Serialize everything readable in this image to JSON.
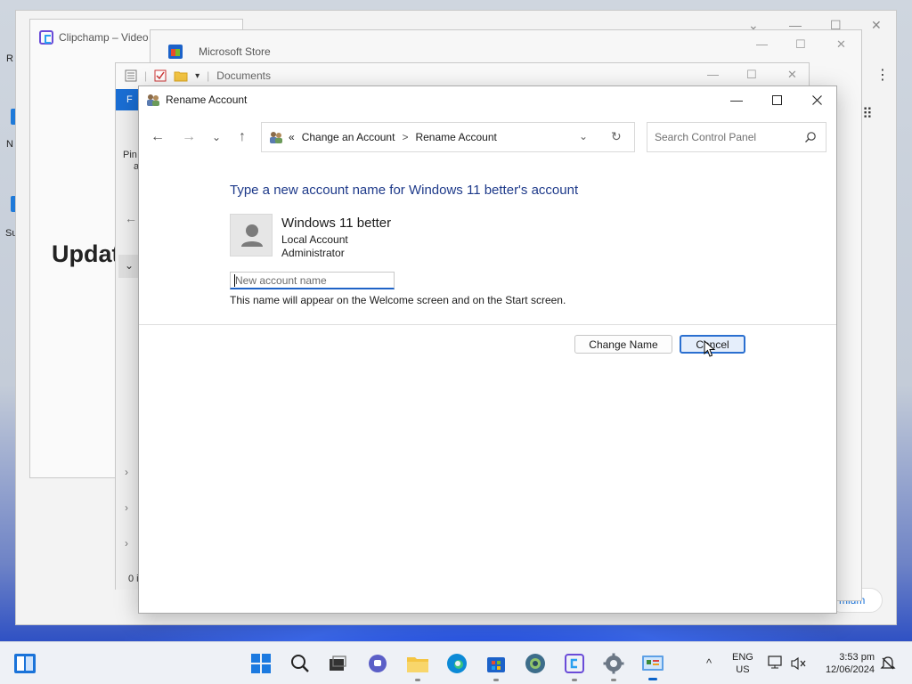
{
  "background": {
    "clipchamp": {
      "title": "Clipchamp – Video",
      "heading": "Updat"
    },
    "store": {
      "title": "Microsoft Store"
    },
    "documents": {
      "title": "Documents",
      "ribbon_tab": "F",
      "pin_text": "Pin",
      "pin_text2": "a",
      "status_text": "0 i"
    },
    "premium_badge": "mium",
    "desktop_fragments": [
      "R",
      "N",
      "Su"
    ]
  },
  "dialog": {
    "title": "Rename Account",
    "address": {
      "overflow": "«",
      "crumbs": [
        "Change an Account",
        "Rename Account"
      ],
      "separator": ">"
    },
    "search": {
      "placeholder": "Search Control Panel"
    },
    "heading": "Type a new account name for Windows 11 better's account",
    "account": {
      "name": "Windows 11 better",
      "type": "Local Account",
      "role": "Administrator"
    },
    "new_name_input": {
      "placeholder": "New account name",
      "value": ""
    },
    "help_text": "This name will appear on the Welcome screen and on the Start screen.",
    "buttons": {
      "change_name": "Change Name",
      "cancel": "Cancel"
    }
  },
  "taskbar": {
    "icons": [
      "start-icon",
      "search-icon",
      "task-view-icon",
      "teams-chat-icon",
      "file-explorer-icon",
      "edge-icon",
      "microsoft-store-icon",
      "linux-distro-icon",
      "clipchamp-icon",
      "settings-icon",
      "control-panel-icon"
    ],
    "language": "ENG",
    "region": "US",
    "time": "3:53 pm",
    "date": "12/06/2024"
  },
  "colors": {
    "accent": "#1f63c6",
    "heading_blue": "#1e3a8a",
    "taskbar_bg": "#eef1f6"
  }
}
